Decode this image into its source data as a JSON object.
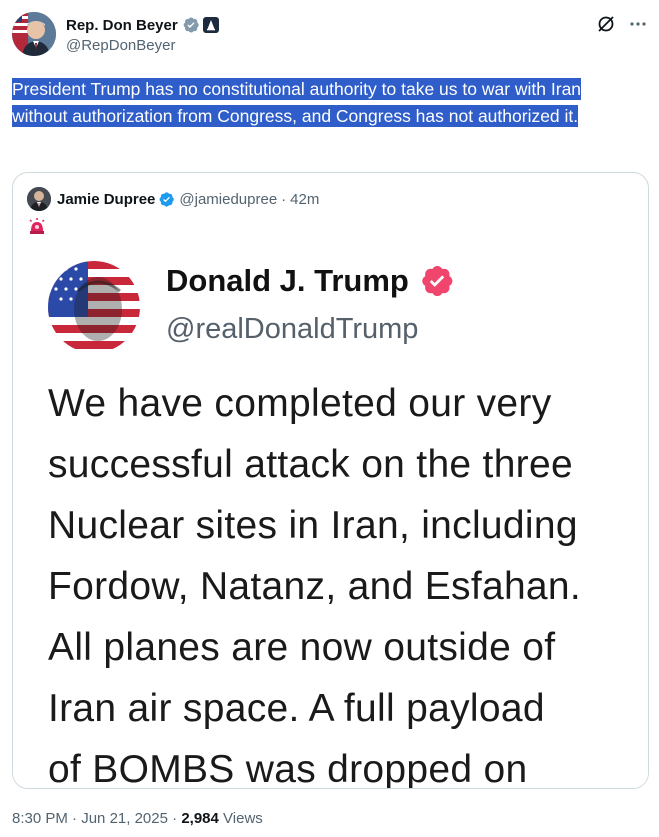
{
  "author": {
    "name": "Rep. Don Beyer",
    "handle": "@RepDonBeyer",
    "verified_color": "#829aab"
  },
  "icons": {
    "grok": "grok-icon",
    "more": "more-icon"
  },
  "tweet": {
    "text": "President Trump has no constitutional authority to take us to war with Iran without authorization from Congress, and Congress has not authorized it."
  },
  "quote": {
    "name": "Jamie Dupree",
    "handle": "@jamiedupree",
    "separator": "·",
    "time": "42m",
    "emoji": "siren-icon",
    "screenshot": {
      "name": "Donald J. Trump",
      "handle": "@realDonaldTrump",
      "body_lines": [
        "We have completed our very",
        "successful attack on the three",
        "Nuclear sites in Iran, including",
        "Fordow, Natanz, and Esfahan.",
        "All planes are now outside of",
        "Iran air space. A full payload",
        "of BOMBS was dropped on"
      ],
      "badge_color": "#f0466e"
    }
  },
  "meta": {
    "time": "8:30 PM",
    "sep1": "·",
    "date": "Jun 21, 2025",
    "sep2": "·",
    "views_count": "2,984",
    "views_label": "Views"
  }
}
